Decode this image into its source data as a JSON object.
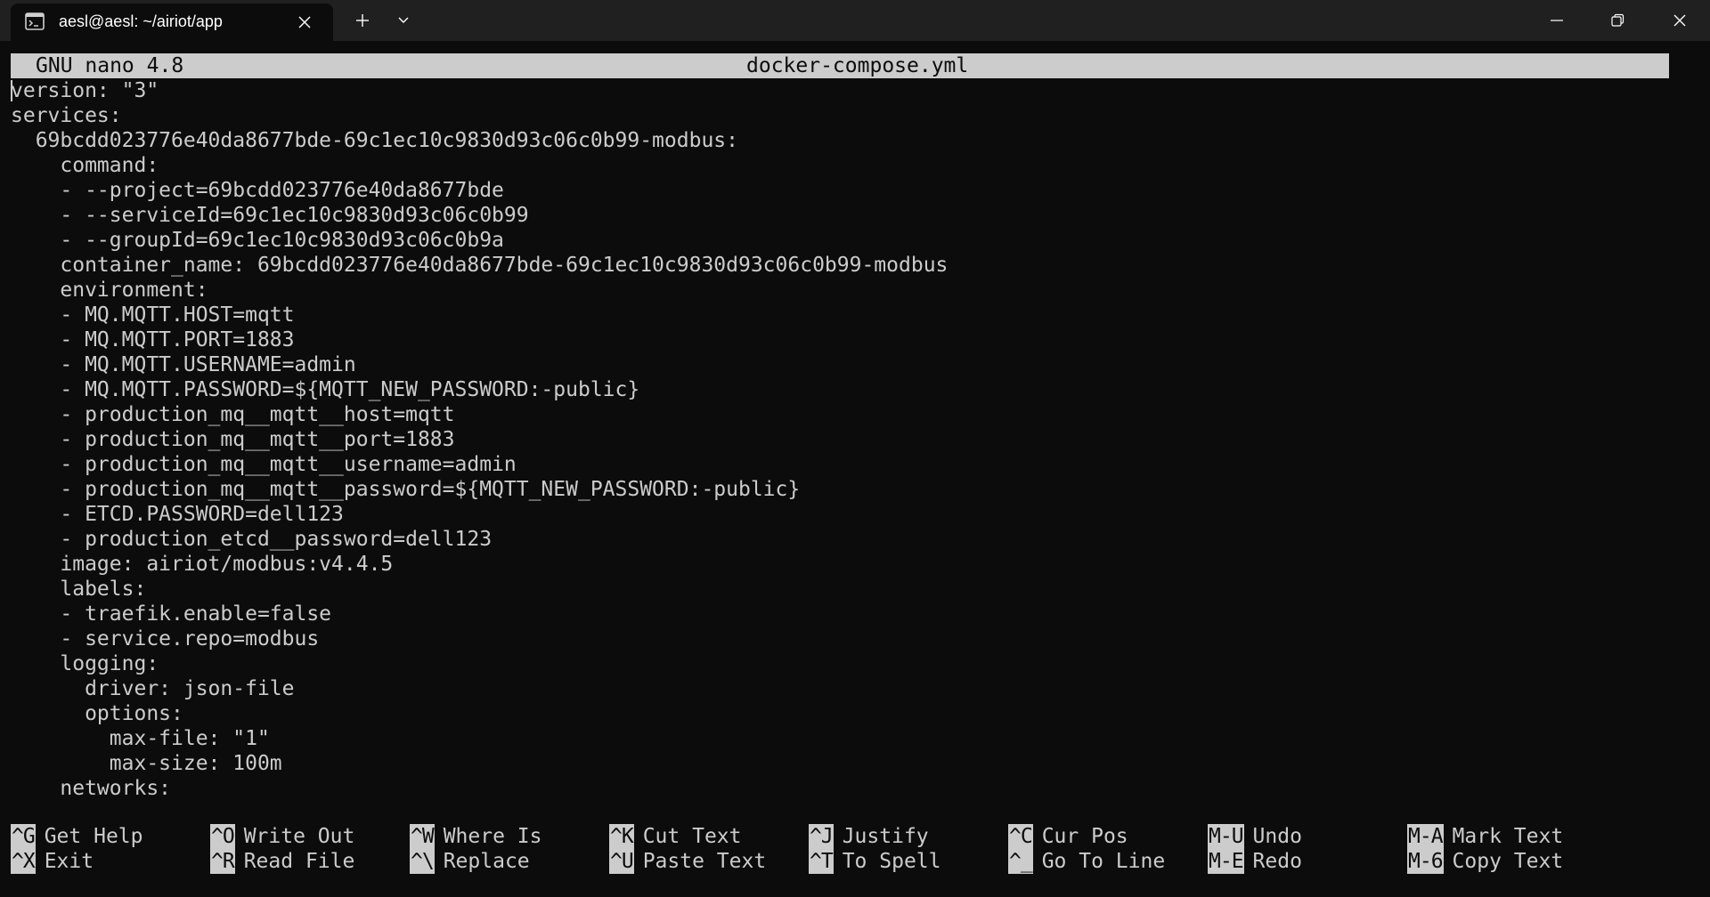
{
  "window": {
    "tab_title": "aesl@aesl: ~/airiot/app"
  },
  "nano": {
    "version": "GNU nano 4.8",
    "filename": "docker-compose.yml"
  },
  "file_lines": [
    "version: \"3\"",
    "services:",
    "  69bcdd023776e40da8677bde-69c1ec10c9830d93c06c0b99-modbus:",
    "    command:",
    "    - --project=69bcdd023776e40da8677bde",
    "    - --serviceId=69c1ec10c9830d93c06c0b99",
    "    - --groupId=69c1ec10c9830d93c06c0b9a",
    "    container_name: 69bcdd023776e40da8677bde-69c1ec10c9830d93c06c0b99-modbus",
    "    environment:",
    "    - MQ.MQTT.HOST=mqtt",
    "    - MQ.MQTT.PORT=1883",
    "    - MQ.MQTT.USERNAME=admin",
    "    - MQ.MQTT.PASSWORD=${MQTT_NEW_PASSWORD:-public}",
    "    - production_mq__mqtt__host=mqtt",
    "    - production_mq__mqtt__port=1883",
    "    - production_mq__mqtt__username=admin",
    "    - production_mq__mqtt__password=${MQTT_NEW_PASSWORD:-public}",
    "    - ETCD.PASSWORD=dell123",
    "    - production_etcd__password=dell123",
    "    image: airiot/modbus:v4.4.5",
    "    labels:",
    "    - traefik.enable=false",
    "    - service.repo=modbus",
    "    logging:",
    "      driver: json-file",
    "      options:",
    "        max-file: \"1\"",
    "        max-size: 100m",
    "    networks:"
  ],
  "shortcuts": [
    {
      "key": "^G",
      "label": "Get Help"
    },
    {
      "key": "^O",
      "label": "Write Out"
    },
    {
      "key": "^W",
      "label": "Where Is"
    },
    {
      "key": "^K",
      "label": "Cut Text"
    },
    {
      "key": "^J",
      "label": "Justify"
    },
    {
      "key": "^C",
      "label": "Cur Pos"
    },
    {
      "key": "M-U",
      "label": "Undo"
    },
    {
      "key": "M-A",
      "label": "Mark Text"
    },
    {
      "key": "^X",
      "label": "Exit"
    },
    {
      "key": "^R",
      "label": "Read File"
    },
    {
      "key": "^\\",
      "label": "Replace"
    },
    {
      "key": "^U",
      "label": "Paste Text"
    },
    {
      "key": "^T",
      "label": "To Spell"
    },
    {
      "key": "^_",
      "label": "Go To Line"
    },
    {
      "key": "M-E",
      "label": "Redo"
    },
    {
      "key": "M-6",
      "label": "Copy Text"
    }
  ],
  "colors": {
    "terminal_bg": "#0c0c0c",
    "terminal_fg": "#cccccc",
    "titlebar_bg": "#202020"
  },
  "icons": {
    "tab": "terminal-icon",
    "tab_close": "close-icon",
    "new_tab": "plus-icon",
    "dropdown": "chevron-down-icon",
    "minimize": "minimize-icon",
    "maximize": "restore-icon",
    "close": "close-icon"
  }
}
